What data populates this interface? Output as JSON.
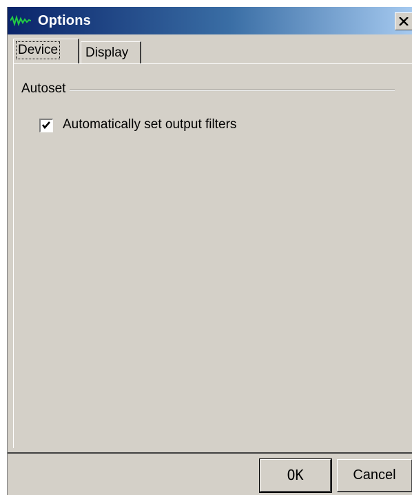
{
  "window": {
    "title": "Options",
    "close_symbol": "×"
  },
  "tabs": [
    {
      "label": "Device",
      "selected": true
    },
    {
      "label": "Display",
      "selected": false
    }
  ],
  "device_tab": {
    "group_label": "Autoset",
    "auto_filters": {
      "label": "Automatically set output filters",
      "checked": true
    }
  },
  "buttons": {
    "ok_label": "OK",
    "cancel_label": "Cancel"
  },
  "colors": {
    "titlebar_start": "#0a246a",
    "titlebar_end": "#a6caf0",
    "face": "#d4d0c8",
    "app_icon": "#22aa22"
  },
  "icons": {
    "app": "waveform-icon",
    "close": "close-icon",
    "check": "checkmark-icon"
  }
}
